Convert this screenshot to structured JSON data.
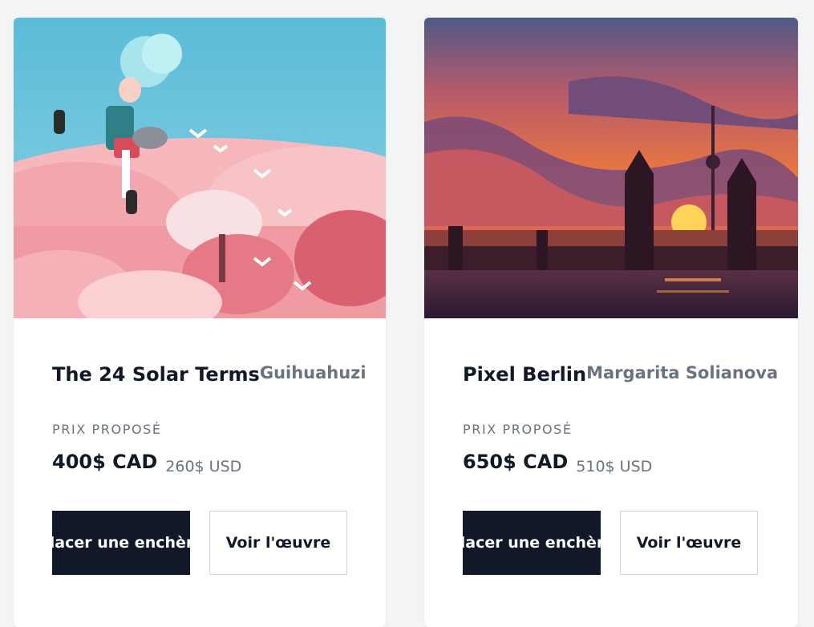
{
  "cards": [
    {
      "title": "The 24 Solar Terms",
      "artist": "Guihuahuzi",
      "price_label": "PRIX PROPOSÉ",
      "price_cad": "400$ CAD",
      "price_usd": "260$ USD",
      "bid_button": "Placer une enchère",
      "view_button": "Voir l'œuvre"
    },
    {
      "title": "Pixel Berlin",
      "artist": "Margarita Solianova",
      "price_label": "PRIX PROPOSÉ",
      "price_cad": "650$ CAD",
      "price_usd": "510$ USD",
      "bid_button": "Placer une enchère",
      "view_button": "Voir l'œuvre"
    }
  ],
  "colors": {
    "page_bg": "#f3f4f6",
    "card_bg": "#ffffff",
    "primary": "#111827",
    "muted": "#6b7280",
    "border": "#d1d5db"
  }
}
